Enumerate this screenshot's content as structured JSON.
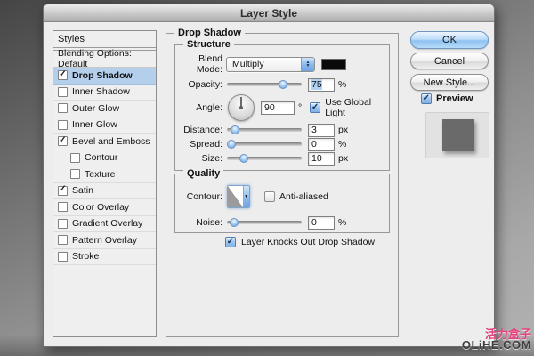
{
  "window": {
    "title": "Layer Style"
  },
  "icons": {
    "check": "✓",
    "arrow_up": "▲",
    "arrow_down": "▼"
  },
  "sidebar": {
    "header": "Styles",
    "blending": "Blending Options: Default",
    "items": [
      {
        "label": "Drop Shadow",
        "checked": true,
        "selected": true
      },
      {
        "label": "Inner Shadow",
        "checked": false
      },
      {
        "label": "Outer Glow",
        "checked": false
      },
      {
        "label": "Inner Glow",
        "checked": false
      },
      {
        "label": "Bevel and Emboss",
        "checked": true
      },
      {
        "label": "Contour",
        "checked": false,
        "indent": true
      },
      {
        "label": "Texture",
        "checked": false,
        "indent": true
      },
      {
        "label": "Satin",
        "checked": true
      },
      {
        "label": "Color Overlay",
        "checked": false
      },
      {
        "label": "Gradient Overlay",
        "checked": false
      },
      {
        "label": "Pattern Overlay",
        "checked": false
      },
      {
        "label": "Stroke",
        "checked": false
      }
    ]
  },
  "panel": {
    "title": "Drop Shadow",
    "structure": {
      "title": "Structure",
      "blend_mode": {
        "label": "Blend Mode:",
        "value": "Multiply",
        "swatch_color": "#0a0a0a"
      },
      "opacity": {
        "label": "Opacity:",
        "value": "75",
        "unit": "%"
      },
      "angle": {
        "label": "Angle:",
        "value": "90",
        "unit": "°",
        "use_global_light": "Use Global Light"
      },
      "distance": {
        "label": "Distance:",
        "value": "3",
        "unit": "px"
      },
      "spread": {
        "label": "Spread:",
        "value": "0",
        "unit": "%"
      },
      "size": {
        "label": "Size:",
        "value": "10",
        "unit": "px"
      }
    },
    "quality": {
      "title": "Quality",
      "contour": {
        "label": "Contour:"
      },
      "anti_aliased": "Anti-aliased",
      "noise": {
        "label": "Noise:",
        "value": "0",
        "unit": "%"
      }
    },
    "knockout": "Layer Knocks Out Drop Shadow"
  },
  "actions": {
    "ok": "OK",
    "cancel": "Cancel",
    "new_style": "New Style...",
    "preview": "Preview"
  },
  "watermark": {
    "line1": "活力盒子",
    "line2": "OLiHE.COM"
  }
}
